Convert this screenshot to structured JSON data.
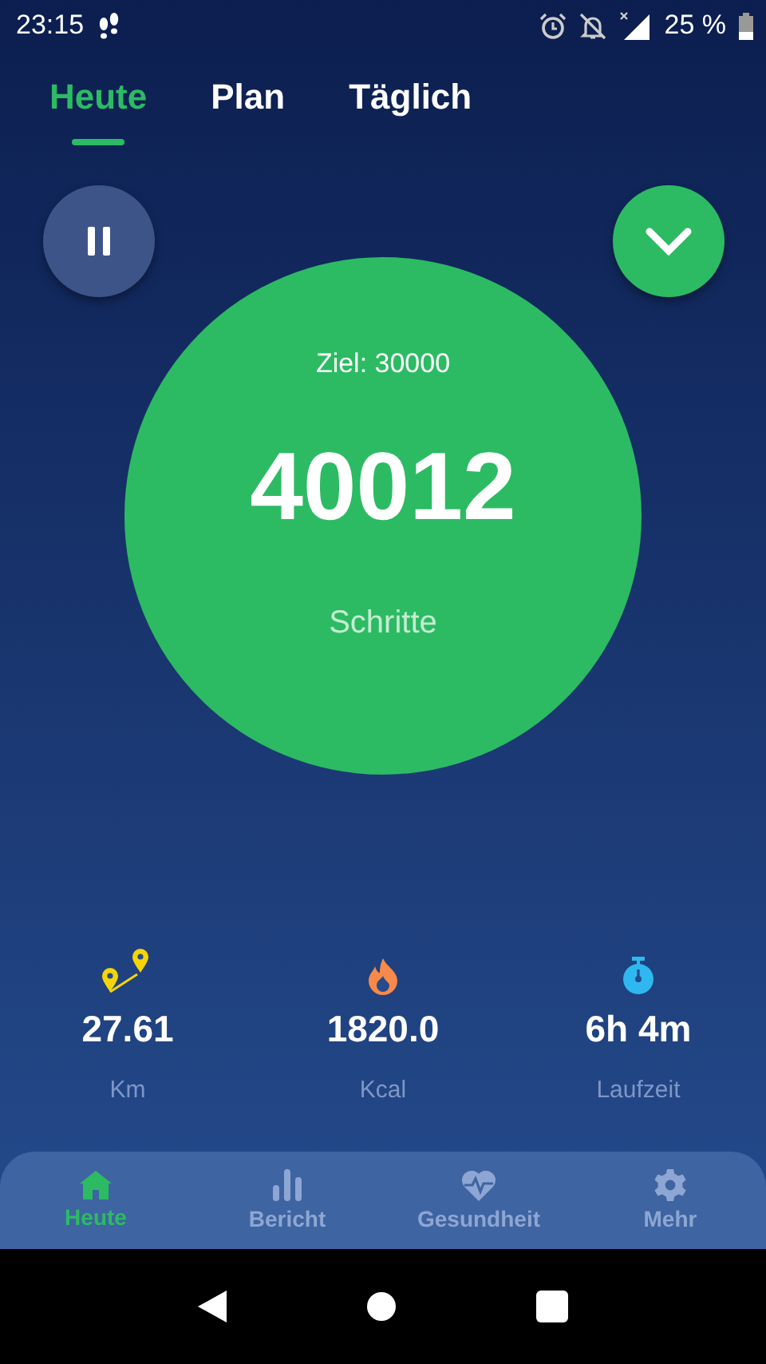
{
  "status_bar": {
    "time": "23:15",
    "battery": "25 %"
  },
  "tabs": [
    {
      "label": "Heute",
      "selected": true
    },
    {
      "label": "Plan",
      "selected": false
    },
    {
      "label": "Täglich",
      "selected": false
    }
  ],
  "goal": "Ziel: 30000",
  "steps": "40012",
  "steps_label": "Schritte",
  "stats": [
    {
      "kind": "distance",
      "value": "27.61",
      "unit": "Km"
    },
    {
      "kind": "calories",
      "value": "1820.0",
      "unit": "Kcal"
    },
    {
      "kind": "time",
      "value": "6h 4m",
      "unit": "Laufzeit"
    }
  ],
  "nav": [
    {
      "kind": "home",
      "label": "Heute",
      "selected": true
    },
    {
      "kind": "report",
      "label": "Bericht",
      "selected": false
    },
    {
      "kind": "health",
      "label": "Gesundheit",
      "selected": false
    },
    {
      "kind": "more",
      "label": "Mehr",
      "selected": false
    }
  ]
}
